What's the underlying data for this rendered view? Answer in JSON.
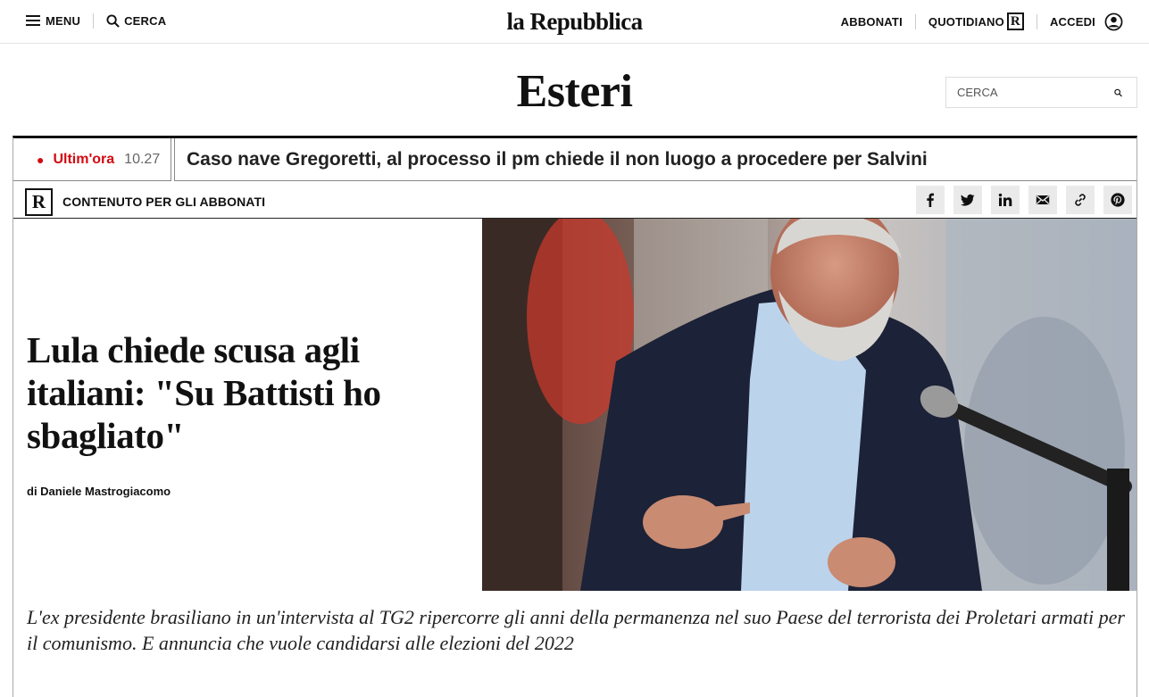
{
  "topbar": {
    "menu_label": "MENU",
    "search_label": "CERCA",
    "logo": "la Repubblica",
    "subscribe_label": "ABBONATI",
    "newspaper_label": "QUOTIDIANO",
    "newspaper_badge": "R",
    "login_label": "ACCEDI"
  },
  "section": {
    "title": "Esteri",
    "search_placeholder": "CERCA"
  },
  "breaking": {
    "label": "Ultim'ora",
    "time": "10.27",
    "headline": "Caso nave Gregoretti, al processo il pm chiede il non luogo a procedere per Salvini"
  },
  "subscriber": {
    "badge": "R",
    "label": "CONTENUTO PER GLI ABBONATI"
  },
  "share_icons": [
    "facebook-icon",
    "twitter-icon",
    "linkedin-icon",
    "mail-icon",
    "link-icon",
    "pinterest-icon"
  ],
  "article": {
    "headline": "Lula chiede scusa agli italiani: \"Su Battisti ho sbagliato\"",
    "byline": "di Daniele Mastrogiacomo",
    "summary": "L'ex presidente brasiliano in un'intervista al TG2 ripercorre gli anni della permanenza nel suo Paese del terrorista dei Proletari armati per il comunismo. E annuncia che vuole candidarsi alle elezioni del 2022"
  },
  "colors": {
    "accent_red": "#d20a11",
    "text": "#111111",
    "share_bg": "#eaeaea"
  }
}
